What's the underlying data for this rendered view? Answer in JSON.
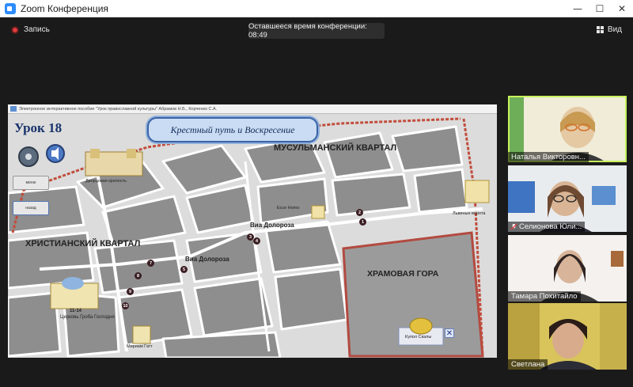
{
  "window": {
    "title": "Zoom Конференция",
    "minimize_glyph": "—",
    "maximize_glyph": "☐",
    "close_glyph": "✕"
  },
  "toolbar": {
    "record_label": "Запись",
    "timer_text": "Оставшееся время конференции: 08:49",
    "view_label": "Вид",
    "record_color": "#e03c3c"
  },
  "shared_screen": {
    "window_title": "Электронное интерактивное пособие \"Урок православной культуры\" Абрамов Н.Б., Корченко С.А.",
    "lesson_title": "Урок 18",
    "banner_text": "Крестный путь и Воскресение",
    "labels": {
      "muslim_quarter": "МУСУЛЬМАНСКИЙ КВАРТАЛ",
      "christian_quarter": "ХРИСТИАНСКИЙ КВАРТАЛ",
      "temple_mount": "ХРАМОВАЯ ГОРА",
      "via_dolorosa_1": "Виа Долороза",
      "via_dolorosa_2": "Виа Долороза",
      "lions_gate": "Львиные ворота",
      "church_sepulchre": "Церковь Гроба Господня",
      "church_number": "11-14",
      "dome_rock": "Купол Скалы",
      "antonia": "Дворцовая крепость",
      "ecce_homo": "Ecce Homo",
      "wall_label": "Мириам Гатт"
    },
    "nav_buttons": [
      "меню",
      "назад"
    ],
    "stations": [
      "1",
      "2",
      "3",
      "4",
      "5",
      "6",
      "7",
      "8",
      "9",
      "10"
    ],
    "close_glyph": "✕"
  },
  "participants": [
    {
      "name": "Наталья Викторовн...",
      "muted": false,
      "active": true
    },
    {
      "name": "Селионова Юли...",
      "muted": true,
      "active": false
    },
    {
      "name": "Тамара Похитайло",
      "muted": false,
      "active": false
    },
    {
      "name": "Светлана",
      "muted": false,
      "active": false
    }
  ]
}
